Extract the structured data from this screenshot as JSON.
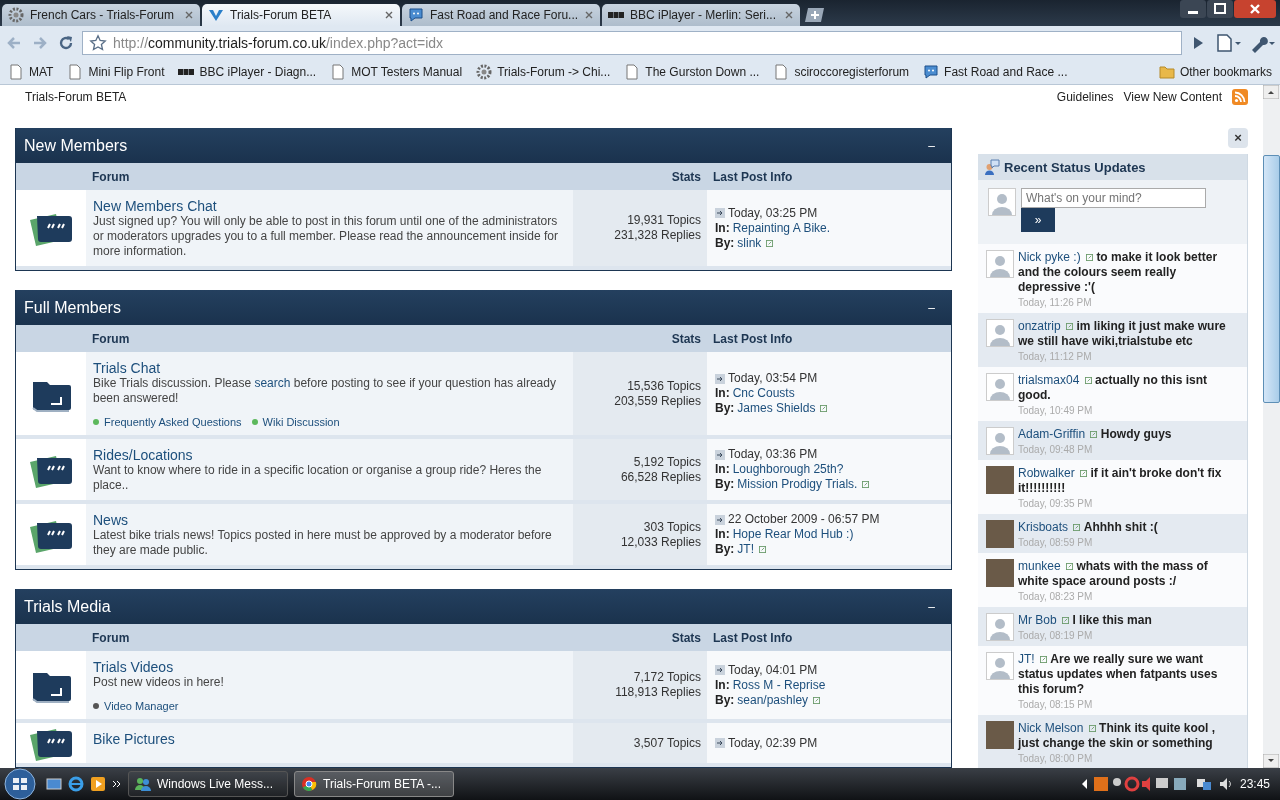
{
  "browser": {
    "tabs": [
      {
        "title": "French Cars - Trials-Forum",
        "kind": "gear",
        "selected": false
      },
      {
        "title": "Trials-Forum BETA",
        "kind": "logo",
        "selected": true
      },
      {
        "title": "Fast Road and Race Foru...",
        "kind": "bubble",
        "selected": false
      },
      {
        "title": "BBC iPlayer - Merlin: Seri...",
        "kind": "bbc",
        "selected": false
      }
    ],
    "url": {
      "scheme": "http://",
      "host": "community.trials-forum.co.uk",
      "path": "/index.php?act=idx"
    },
    "bookmarks": [
      {
        "label": "MAT",
        "kind": "page"
      },
      {
        "label": "Mini Flip Front",
        "kind": "page"
      },
      {
        "label": "BBC iPlayer - Diagn...",
        "kind": "bbc"
      },
      {
        "label": "MOT Testers Manual",
        "kind": "page"
      },
      {
        "label": "Trials-Forum -> Chi...",
        "kind": "gear"
      },
      {
        "label": "The Gurston Down ...",
        "kind": "page"
      },
      {
        "label": "sciroccoregisterforum",
        "kind": "page"
      },
      {
        "label": "Fast Road and Race ...",
        "kind": "bubble"
      }
    ],
    "other_bookmarks": "Other bookmarks"
  },
  "site_title": "Trials-Forum BETA",
  "header_links": [
    "Guidelines",
    "View New Content"
  ],
  "categories": [
    {
      "title": "New Members",
      "collapse": "–",
      "columns": [
        "Forum",
        "Stats",
        "Last Post Info"
      ],
      "forums": [
        {
          "kind": "bubble",
          "name": "New Members Chat",
          "description": [
            {
              "text": "Just signed up? You will only be able to post in this forum until one of the administrators or moderators upgrades you to a full member. Please read the announcement inside for more information.",
              "kind": "text"
            }
          ],
          "topics": "19,931 Topics",
          "replies": "231,328 Replies",
          "date": "Today, 03:25 PM",
          "in_label": "In:",
          "topic": "Repainting A Bike.",
          "by_label": "By:",
          "user": "slink"
        }
      ]
    },
    {
      "title": "Full Members",
      "collapse": "–",
      "columns": [
        "Forum",
        "Stats",
        "Last Post Info"
      ],
      "forums": [
        {
          "kind": "folder",
          "name": "Trials Chat",
          "description": [
            {
              "text": "Bike Trials discussion. Please ",
              "kind": "text"
            },
            {
              "text": "search",
              "kind": "link"
            },
            {
              "text": " before posting to see if your question has already been answered!",
              "kind": "text"
            }
          ],
          "sublinks": [
            {
              "label": "Frequently Asked Questions",
              "color": "#5cb85c"
            },
            {
              "label": "Wiki Discussion",
              "color": "#5cb85c"
            }
          ],
          "topics": "15,536 Topics",
          "replies": "203,559 Replies",
          "date": "Today, 03:54 PM",
          "in_label": "In:",
          "topic": "Cnc Cousts",
          "by_label": "By:",
          "user": "James Shields"
        },
        {
          "kind": "bubble",
          "name": "Rides/Locations",
          "description": [
            {
              "text": "Want to know where to ride in a specific location or organise a group ride? Heres the place..",
              "kind": "text"
            }
          ],
          "topics": "5,192 Topics",
          "replies": "66,528 Replies",
          "date": "Today, 03:36 PM",
          "in_label": "In:",
          "topic": "Loughborough 25th?",
          "by_label": "By:",
          "user": "Mission Prodigy Trials."
        },
        {
          "kind": "bubble",
          "name": "News",
          "description": [
            {
              "text": "Latest bike trials news! Topics posted in here must be approved by a moderator before they are made public.",
              "kind": "text"
            }
          ],
          "topics": "303 Topics",
          "replies": "12,033 Replies",
          "date": "22 October 2009 - 06:57 PM",
          "in_label": "In:",
          "topic": "Hope Rear Mod Hub :)",
          "by_label": "By:",
          "user": "JT!"
        }
      ]
    },
    {
      "title": "Trials Media",
      "collapse": "–",
      "columns": [
        "Forum",
        "Stats",
        "Last Post Info"
      ],
      "forums": [
        {
          "kind": "folder",
          "name": "Trials Videos",
          "description": [
            {
              "text": "Post new videos in here!",
              "kind": "text"
            }
          ],
          "sublinks": [
            {
              "label": "Video Manager",
              "color": "#555555"
            }
          ],
          "topics": "7,172 Topics",
          "replies": "118,913 Replies",
          "date": "Today, 04:01 PM",
          "in_label": "In:",
          "topic": "Ross M - Reprise",
          "by_label": "By:",
          "user": "sean/pashley"
        },
        {
          "kind": "bubble",
          "name": "Bike Pictures",
          "topics": "3,507 Topics",
          "date": "Today, 02:39 PM"
        }
      ]
    }
  ],
  "sidebar": {
    "close": "×",
    "title": "Recent Status Updates",
    "placeholder": "What's on your mind?",
    "submit": "»",
    "updates": [
      {
        "user": "Nick pyke :)",
        "message": "to make it look better and the colours seem really depressive :'(",
        "time": "Today, 11:26 PM",
        "kind": "default"
      },
      {
        "user": "onzatrip",
        "message": "im liking it just make wure we still have wiki,trialstube etc",
        "time": "Today, 11:12 PM",
        "kind": "default"
      },
      {
        "user": "trialsmax04",
        "message": "actually no this isnt good.",
        "time": "Today, 10:49 PM",
        "kind": "default"
      },
      {
        "user": "Adam-Griffin",
        "message": "Howdy guys",
        "time": "Today, 09:48 PM",
        "kind": "default"
      },
      {
        "user": "Robwalker",
        "message": "if it ain't broke don't fix it!!!!!!!!!!",
        "time": "Today, 09:35 PM",
        "kind": "photo"
      },
      {
        "user": "Krisboats",
        "message": "Ahhhh shit :(",
        "time": "Today, 08:59 PM",
        "kind": "photo"
      },
      {
        "user": "munkee",
        "message": "whats with the mass of white space around posts :/",
        "time": "Today, 08:23 PM",
        "kind": "photo"
      },
      {
        "user": "Mr Bob",
        "message": "I like this man",
        "time": "Today, 08:19 PM",
        "kind": "default"
      },
      {
        "user": "JT!",
        "message": "Are we really sure we want status updates when fatpants uses this forum?",
        "time": "Today, 08:15 PM",
        "kind": "default"
      },
      {
        "user": "Nick Melson",
        "message": "Think its quite kool , just change the skin or something",
        "time": "Today, 08:00 PM",
        "kind": "photo"
      }
    ]
  },
  "taskbar": {
    "tasks": [
      {
        "label": "Windows Live Mess...",
        "kind": "messenger",
        "selected": false
      },
      {
        "label": "Trials-Forum BETA -...",
        "kind": "chrome",
        "selected": true
      }
    ],
    "clock": "23:45"
  }
}
